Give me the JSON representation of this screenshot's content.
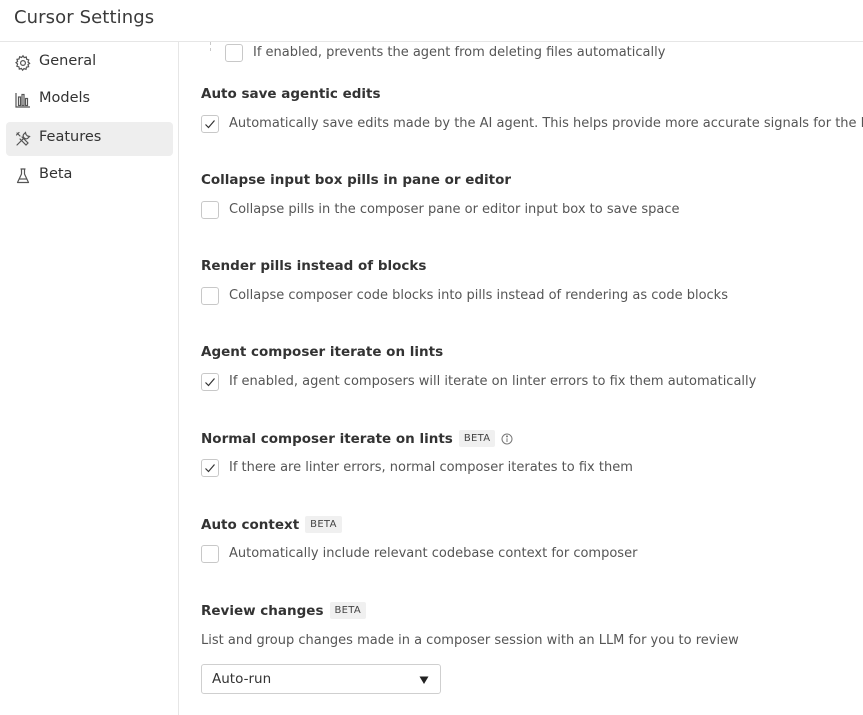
{
  "app": {
    "title": "Cursor Settings"
  },
  "sidebar": {
    "items": [
      {
        "label": "General",
        "icon": "gear-icon",
        "active": false
      },
      {
        "label": "Models",
        "icon": "bar-chart-icon",
        "active": false
      },
      {
        "label": "Features",
        "icon": "tools-icon",
        "active": true
      },
      {
        "label": "Beta",
        "icon": "flask-icon",
        "active": false
      }
    ]
  },
  "main": {
    "partial_item": {
      "label": "If enabled, prevents the agent from deleting files automatically",
      "checked": false
    },
    "sections": [
      {
        "title": "Auto save agentic edits",
        "checkbox": {
          "label": "Automatically save edits made by the AI agent. This helps provide more accurate signals for the LLM",
          "checked": true
        }
      },
      {
        "title": "Collapse input box pills in pane or editor",
        "checkbox": {
          "label": "Collapse pills in the composer pane or editor input box to save space",
          "checked": false
        }
      },
      {
        "title": "Render pills instead of blocks",
        "checkbox": {
          "label": "Collapse composer code blocks into pills instead of rendering as code blocks",
          "checked": false
        }
      },
      {
        "title": "Agent composer iterate on lints",
        "checkbox": {
          "label": "If enabled, agent composers will iterate on linter errors to fix them automatically",
          "checked": true
        }
      },
      {
        "title": "Normal composer iterate on lints",
        "badge": "BETA",
        "info_icon": "info-icon",
        "checkbox": {
          "label": "If there are linter errors, normal composer iterates to fix them",
          "checked": true
        }
      },
      {
        "title": "Auto context",
        "badge": "BETA",
        "checkbox": {
          "label": "Automatically include relevant codebase context for composer",
          "checked": false
        }
      },
      {
        "title": "Review changes",
        "badge": "BETA",
        "description": "List and group changes made in a composer session with an LLM for you to review",
        "select": {
          "value": "Auto-run"
        }
      }
    ]
  }
}
